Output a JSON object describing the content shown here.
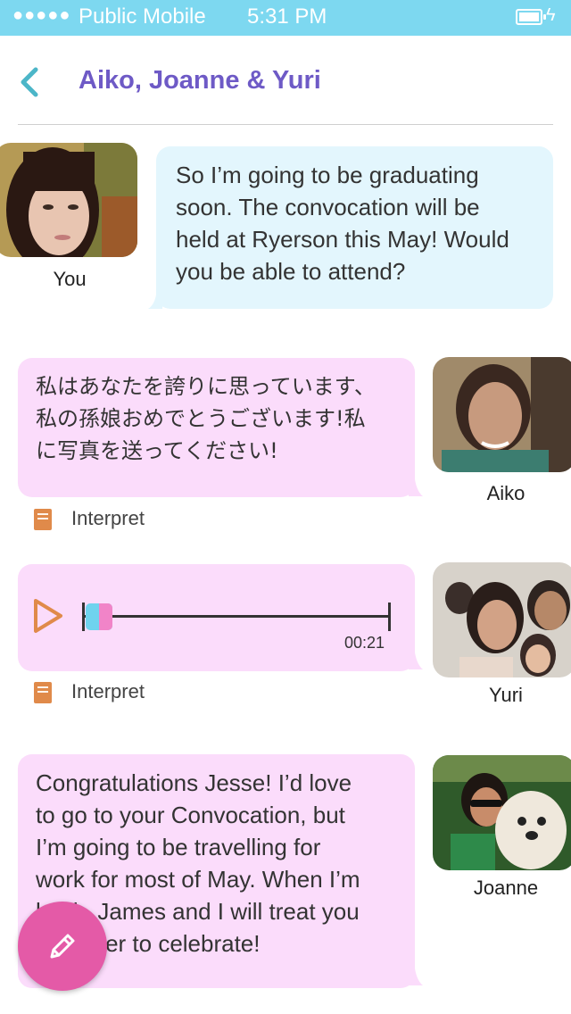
{
  "status_bar": {
    "signal": "●●●●●",
    "carrier": "Public Mobile",
    "time": "5:31 PM",
    "battery_icon": "battery-icon",
    "charging_icon": "bolt-icon"
  },
  "header": {
    "back_icon": "chevron-left-icon",
    "title": "Aiko, Joanne & Yuri"
  },
  "messages": [
    {
      "sender": "You",
      "text_lines": [
        "So I’m going to be graduating",
        "soon. The convocation will be",
        "held at Ryerson this May! Would",
        "you be able to attend?"
      ]
    },
    {
      "sender": "Aiko",
      "text_lines": [
        "私はあなたを誇りに思っています、",
        "私の孫娘おめでとうございます!私",
        "に写真を送ってください!"
      ],
      "interpret_label": "Interpret"
    },
    {
      "sender": "Yuri",
      "audio": {
        "duration": "00:21",
        "progress": 0
      },
      "interpret_label": "Interpret"
    },
    {
      "sender": "Joanne",
      "text_lines": [
        "Congratulations Jesse! I’d love",
        "to go to your Convocation, but",
        "I’m going to be travelling for",
        "work for most of May. When I’m",
        "back, James and I will treat you",
        "to dinner to celebrate!"
      ]
    }
  ],
  "fab": {
    "icon": "pencil-icon"
  },
  "colors": {
    "status_bar": "#7dd8f0",
    "title": "#6e5ac6",
    "bubble_blue": "#e3f6fd",
    "bubble_pink": "#fbdcfb",
    "fab": "#e45aa7",
    "play": "#e08a4a"
  }
}
